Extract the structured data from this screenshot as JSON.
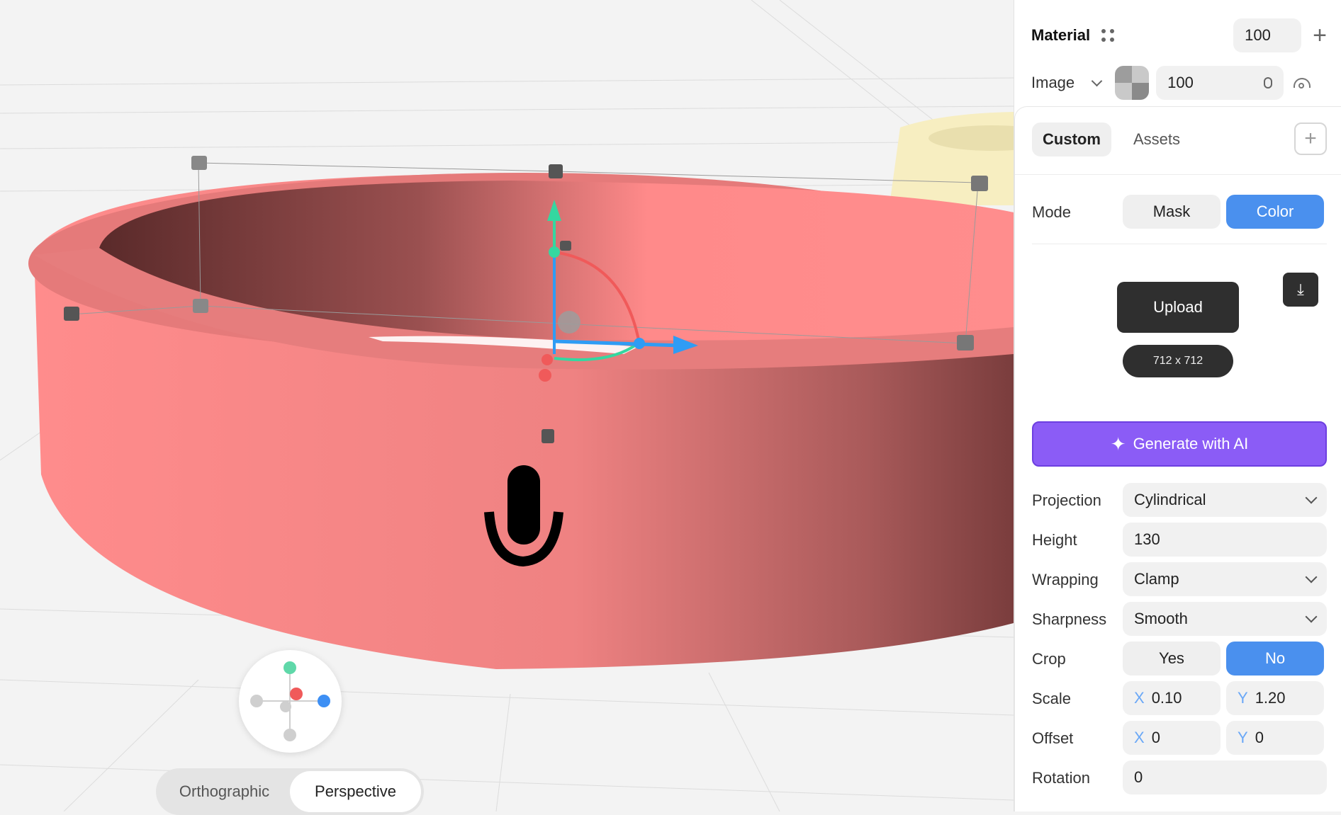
{
  "viewport": {
    "view_options": [
      "Orthographic",
      "Perspective"
    ],
    "active_view": "Perspective",
    "ring_color": "#ff8b8b",
    "object_color": "#f7eec1",
    "decal_icon": "microphone-icon"
  },
  "panel": {
    "material": {
      "label": "Material",
      "value": "100",
      "add_icon": "plus-icon"
    },
    "image": {
      "label": "Image",
      "value": "100",
      "visibility_icon": "eye-icon"
    },
    "tabs": [
      "Custom",
      "Assets"
    ],
    "active_tab": "Custom",
    "mode": {
      "label": "Mode",
      "options": [
        "Mask",
        "Color"
      ],
      "selected": "Color"
    },
    "upload": {
      "button": "Upload",
      "size": "712 x 712",
      "download_icon": "download-icon"
    },
    "generate_label": "Generate with AI",
    "projection": {
      "label": "Projection",
      "value": "Cylindrical"
    },
    "height": {
      "label": "Height",
      "value": "130"
    },
    "wrapping": {
      "label": "Wrapping",
      "value": "Clamp"
    },
    "sharpness": {
      "label": "Sharpness",
      "value": "Smooth"
    },
    "crop": {
      "label": "Crop",
      "options": [
        "Yes",
        "No"
      ],
      "selected": "No"
    },
    "scale": {
      "label": "Scale",
      "x_axis": "X",
      "x": "0.10",
      "y_axis": "Y",
      "y": "1.20"
    },
    "offset": {
      "label": "Offset",
      "x_axis": "X",
      "x": "0",
      "y_axis": "Y",
      "y": "0"
    },
    "rotation": {
      "label": "Rotation",
      "value": "0"
    }
  }
}
